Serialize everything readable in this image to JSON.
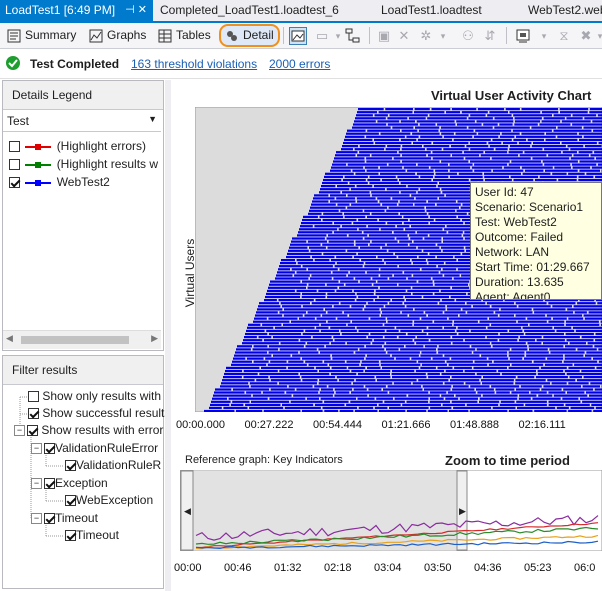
{
  "tabs": [
    {
      "label": "LoadTest1 [6:49 PM]",
      "active": true
    },
    {
      "label": "Completed_LoadTest1.loadtest_6"
    },
    {
      "label": "LoadTest1.loadtest"
    },
    {
      "label": "WebTest2.web"
    }
  ],
  "toolbar": {
    "summary": "Summary",
    "graphs": "Graphs",
    "tables": "Tables",
    "detail": "Detail"
  },
  "status": {
    "text": "Test Completed",
    "violations": "163 threshold violations",
    "errors": "2000 errors"
  },
  "legend": {
    "title": "Details Legend",
    "dropdown_value": "Test",
    "items": [
      {
        "label": "(Highlight errors)",
        "color": "#e00000",
        "checked": false
      },
      {
        "label": "(Highlight results w",
        "color": "#008000",
        "checked": false
      },
      {
        "label": "WebTest2",
        "color": "#0000ff",
        "checked": true
      }
    ]
  },
  "filter": {
    "title": "Filter results",
    "items": [
      {
        "label": "Show only results with",
        "checked": false
      },
      {
        "label": "Show successful results",
        "checked": true
      },
      {
        "label": "Show results with error",
        "checked": true
      },
      {
        "label": "ValidationRuleError",
        "checked": true
      },
      {
        "label": "ValidationRuleR",
        "checked": true
      },
      {
        "label": "Exception",
        "checked": true
      },
      {
        "label": "WebException",
        "checked": true
      },
      {
        "label": "Timeout",
        "checked": true
      },
      {
        "label": "Timeout",
        "checked": true
      }
    ]
  },
  "chart_data": {
    "type": "bar",
    "title": "Virtual User Activity Chart",
    "ylabel": "Virtual Users",
    "x_ticks": [
      "00:00.000",
      "00:27.222",
      "00:54.444",
      "01:21.666",
      "01:48.888",
      "02:16.111"
    ],
    "series": [
      {
        "name": "WebTest2",
        "color": "#0000ff"
      }
    ]
  },
  "tooltip": {
    "user_id": "User Id: 47",
    "scenario": "Scenario: Scenario1",
    "test": "Test: WebTest2",
    "outcome": "Outcome: Failed",
    "network": "Network: LAN",
    "start_time": "Start Time: 01:29.667",
    "duration": "Duration: 13.635",
    "agent": "Agent: Agent0"
  },
  "reference": {
    "label": "Reference graph: Key Indicators",
    "zoom_title": "Zoom to time period",
    "x_ticks": [
      "00:00",
      "00:46",
      "01:32",
      "02:18",
      "03:04",
      "03:50",
      "04:36",
      "05:23",
      "06:0"
    ]
  },
  "colors": {
    "accent": "#007acc",
    "bars": "#0000e8",
    "highlight_ring": "#f0901c"
  }
}
